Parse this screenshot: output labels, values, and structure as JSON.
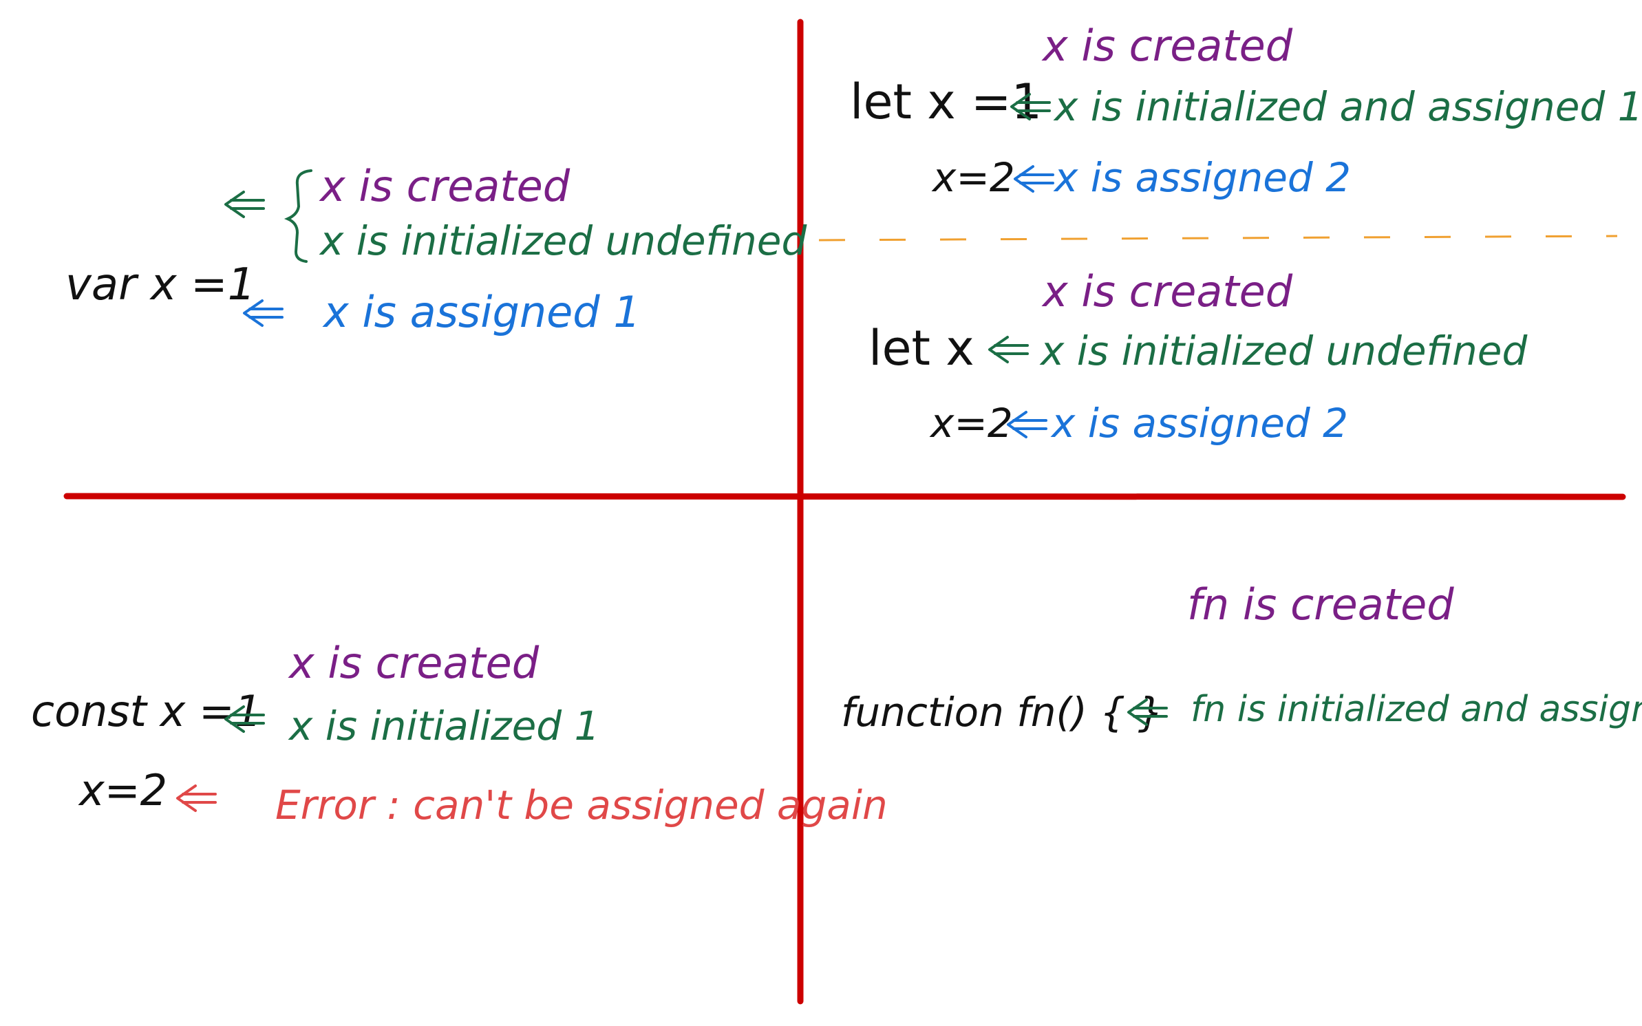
{
  "colors": {
    "divider": "#cc0000",
    "dashed_divider": "#f0a030",
    "code": "#111111",
    "created": "#7a1f86",
    "initialized": "#1b6e45",
    "assigned": "#1a73d9",
    "error": "#e04848"
  },
  "var_block": {
    "code": "var x =1",
    "created": "x is created",
    "initialized": "x is initialized undefined",
    "assigned": "x is assigned 1"
  },
  "let_block_1": {
    "code": "let x =1",
    "created": "x is created",
    "initialized": "x is initialized and assigned 1",
    "reassign_code": "x=2",
    "reassigned": "x is assigned 2"
  },
  "let_block_2": {
    "code": "let x",
    "created": "x is created",
    "initialized": "x is initialized undefined",
    "reassign_code": "x=2",
    "reassigned": "x is assigned 2"
  },
  "const_block": {
    "code": "const x =1",
    "created": "x is created",
    "initialized": "x is initialized 1",
    "reassign_code": "x=2",
    "error": "Error : can't be assigned again"
  },
  "function_block": {
    "code": "function fn() { }",
    "created": "fn is created",
    "initialized": "fn is initialized and assigned"
  },
  "icons": {
    "arrow": "double-left-arrow-icon",
    "brace": "left-brace-icon"
  }
}
